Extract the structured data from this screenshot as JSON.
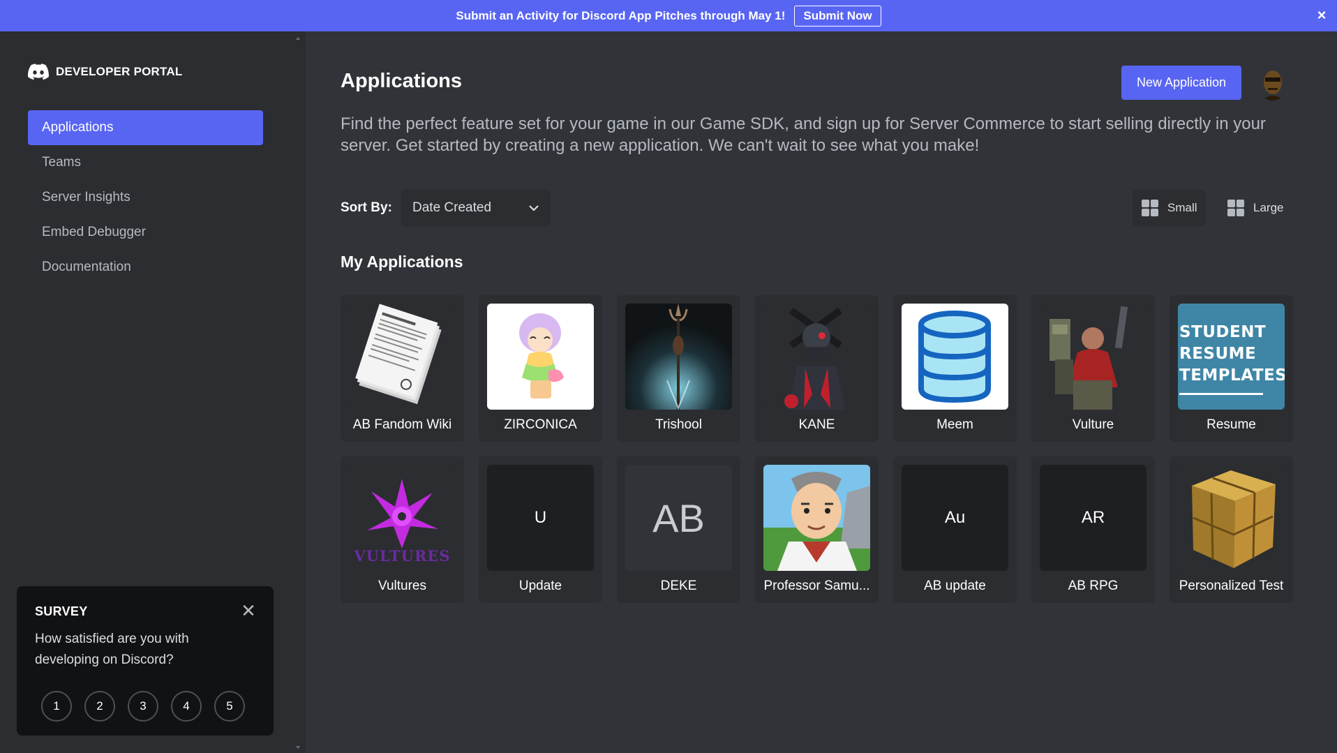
{
  "banner": {
    "text": "Submit an Activity for Discord App Pitches through May 1!",
    "button_label": "Submit Now",
    "close_glyph": "×"
  },
  "sidebar": {
    "brand": "DEVELOPER PORTAL",
    "items": [
      {
        "label": "Applications",
        "active": true
      },
      {
        "label": "Teams",
        "active": false
      },
      {
        "label": "Server Insights",
        "active": false
      },
      {
        "label": "Embed Debugger",
        "active": false
      },
      {
        "label": "Documentation",
        "active": false
      }
    ]
  },
  "survey": {
    "title": "SURVEY",
    "question": "How satisfied are you with developing on Discord?",
    "ratings": [
      "1",
      "2",
      "3",
      "4",
      "5"
    ],
    "close_glyph": "✕"
  },
  "header": {
    "title": "Applications",
    "new_button_label": "New Application",
    "intro": "Find the perfect feature set for your game in our Game SDK, and sign up for Server Commerce to start selling directly in your server. Get started by creating a new application. We can't wait to see what you make!"
  },
  "sort": {
    "label": "Sort By:",
    "value": "Date Created"
  },
  "view": {
    "small_label": "Small",
    "large_label": "Large",
    "selected": "small"
  },
  "my_apps": {
    "title": "My Applications",
    "apps": [
      {
        "name": "AB Fandom Wiki",
        "icon": "papers-icon"
      },
      {
        "name": "ZIRCONICA",
        "icon": "character-icon"
      },
      {
        "name": "Trishool",
        "icon": "trident-icon"
      },
      {
        "name": "KANE",
        "icon": "robot-icon"
      },
      {
        "name": "Meem",
        "icon": "database-icon"
      },
      {
        "name": "Vulture",
        "icon": "soldier-icon"
      },
      {
        "name": "Resume",
        "icon": "resume-icon",
        "icon_text": "STUDENT RESUME TEMPLATES"
      },
      {
        "name": "Vultures",
        "icon": "vultures-logo-icon",
        "icon_text": "VULTURES"
      },
      {
        "name": "Update",
        "initials": "U"
      },
      {
        "name": "DEKE",
        "initials": "AB"
      },
      {
        "name": "Professor Samu...",
        "icon": "professor-icon"
      },
      {
        "name": "AB update",
        "initials": "Au"
      },
      {
        "name": "AB RPG",
        "initials": "AR"
      },
      {
        "name": "Personalized Test",
        "icon": "gold-cube-icon"
      }
    ]
  },
  "colors": {
    "blurple": "#5865f2",
    "background": "#313338",
    "sidebar": "#2b2d31",
    "card": "#2b2d31"
  }
}
